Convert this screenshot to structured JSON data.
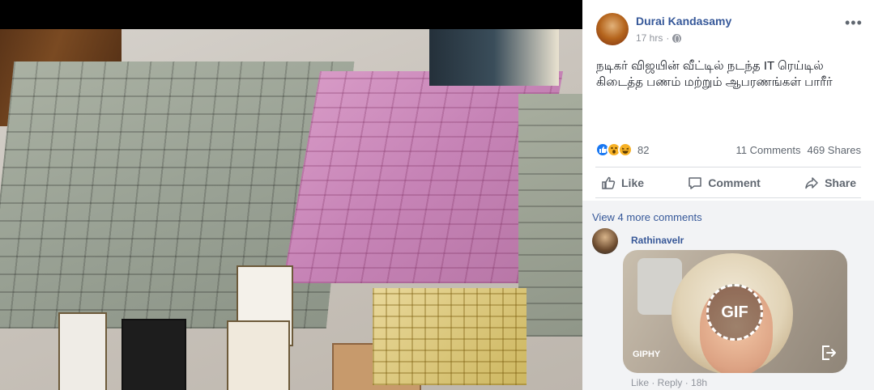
{
  "post": {
    "author": "Durai Kandasamy",
    "time": "17 hrs",
    "text": "நடிகர் விஜயின் வீட்டில் நடந்த IT ரெய்டில் கிடைத்த பணம் மற்றும் ஆபரணங்கள் பாரீர்",
    "more_label": "•••"
  },
  "reactions": {
    "count": "82",
    "icons": [
      "like-icon",
      "wow-icon",
      "haha-icon"
    ]
  },
  "stats": {
    "comments": "11 Comments",
    "shares": "469 Shares"
  },
  "actions": {
    "like": "Like",
    "comment": "Comment",
    "share": "Share"
  },
  "comments": {
    "view_more": "View 4 more comments",
    "first": {
      "author": "Rathinavelr",
      "gif_label": "GIF",
      "gif_source": "GIPHY"
    },
    "next_line": "Like · Reply · 18h"
  },
  "colors": {
    "link": "#365899",
    "meta": "#90949c",
    "text": "#1d2129",
    "comment_bg": "#f2f3f5"
  }
}
